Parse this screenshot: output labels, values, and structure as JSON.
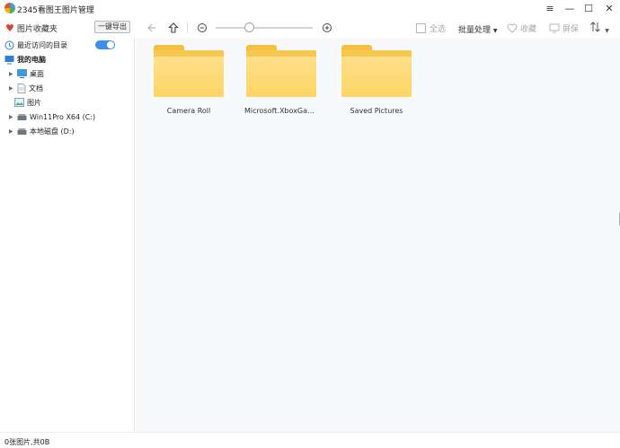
{
  "window": {
    "title": "2345看图王图片管理",
    "controls": [
      "≡",
      "—",
      "☐",
      "✕"
    ]
  },
  "toolbar": {
    "favorites_label": "图片收藏夹",
    "export_label": "一键导出",
    "select_all_label": "全选",
    "batch_label": "批量处理",
    "favorite_label": "收藏",
    "screen_label": "屏保"
  },
  "sidebar": {
    "recent_label": "最近访问的目录",
    "recent_toggle_on": true,
    "computer_label": "我的电脑",
    "items": [
      {
        "label": "桌面",
        "icon": "desktop-icon",
        "expandable": true
      },
      {
        "label": "文档",
        "icon": "document-icon",
        "expandable": true
      },
      {
        "label": "图片",
        "icon": "picture-icon",
        "expandable": false
      },
      {
        "label": "Win11Pro X64 (C:)",
        "icon": "drive-icon",
        "expandable": true
      },
      {
        "label": "本地磁盘 (D:)",
        "icon": "drive-icon",
        "expandable": true
      }
    ]
  },
  "folders": [
    {
      "name": "Camera Roll"
    },
    {
      "name": "Microsoft.XboxGami..."
    },
    {
      "name": "Saved Pictures"
    }
  ],
  "status": {
    "text": "0张图片,共0B"
  },
  "colors": {
    "accent": "#3b8ef0",
    "favorite": "#e53935",
    "folder": "#fdd466",
    "content_bg": "#f7f9fb"
  }
}
